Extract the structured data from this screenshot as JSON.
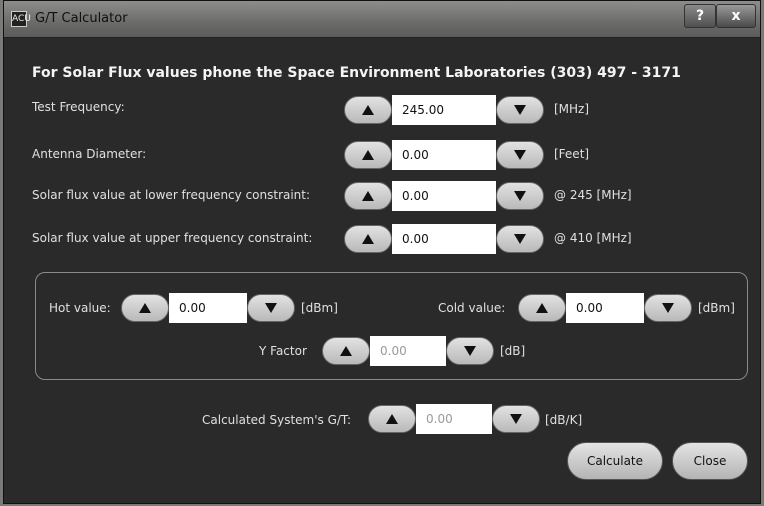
{
  "window": {
    "title": "G/T Calculator",
    "app_icon_text": "ACU",
    "help_label": "?",
    "close_label": "x"
  },
  "heading": "For Solar Flux values phone the Space Environment Laboratories (303) 497 - 3171",
  "fields": {
    "test_frequency": {
      "label": "Test Frequency:",
      "value": "245.00",
      "unit": "[MHz]"
    },
    "antenna_diameter": {
      "label": "Antenna Diameter:",
      "value": "0.00",
      "unit": "[Feet]"
    },
    "solar_lower": {
      "label": "Solar flux value at lower frequency constraint:",
      "value": "0.00",
      "unit": "@ 245 [MHz]"
    },
    "solar_upper": {
      "label": "Solar flux value at upper frequency constraint:",
      "value": "0.00",
      "unit": "@ 410 [MHz]"
    },
    "hot_value": {
      "label": "Hot value:",
      "value": "0.00",
      "unit": "[dBm]"
    },
    "cold_value": {
      "label": "Cold value:",
      "value": "0.00",
      "unit": "[dBm]"
    },
    "y_factor": {
      "label": "Y Factor",
      "value": "0.00",
      "unit": "[dB]"
    },
    "system_gt": {
      "label": "Calculated System's G/T:",
      "value": "0.00",
      "unit": "[dB/K]"
    }
  },
  "buttons": {
    "calculate": "Calculate",
    "close": "Close"
  }
}
